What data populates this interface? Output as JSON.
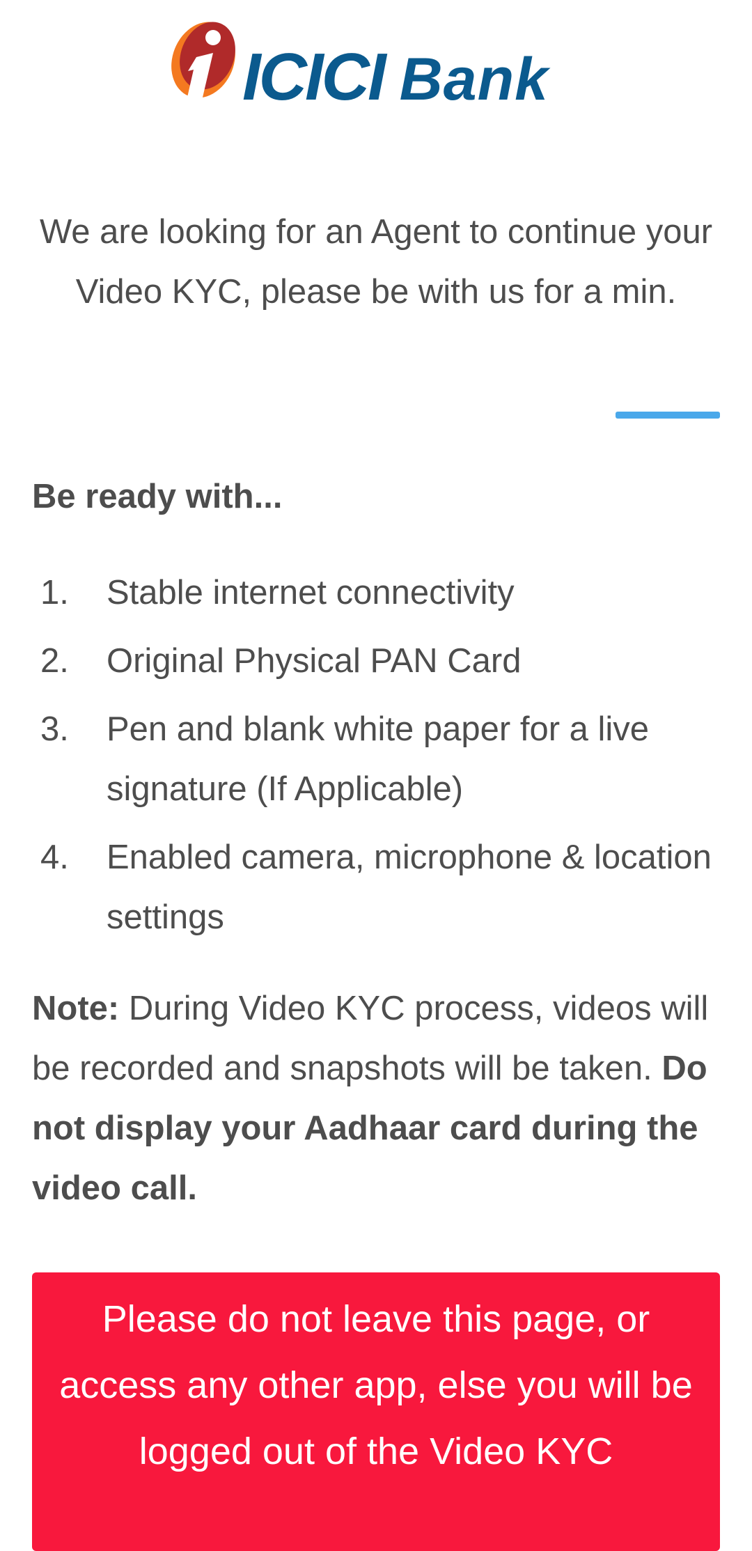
{
  "brand": {
    "name_part1": "ICICI",
    "name_part2": "Bank",
    "primary_color": "#0b5a8e",
    "logo_colors": [
      "#b02a2a",
      "#f47920"
    ]
  },
  "waiting": {
    "message": "We are looking for an Agent to continue your Video KYC, please be with us for a min."
  },
  "loader": {
    "color": "#4aa8ea"
  },
  "checklist": {
    "heading": "Be ready with...",
    "items": [
      {
        "num": "1.",
        "text": "Stable internet connectivity"
      },
      {
        "num": "2.",
        "text": "Original Physical PAN Card"
      },
      {
        "num": "3.",
        "text": "Pen and blank white paper for a live signature (If Applicable)"
      },
      {
        "num": "4.",
        "text": "Enabled camera, microphone & location settings"
      }
    ]
  },
  "note": {
    "label": "Note:",
    "text": " During Video KYC process, videos will be recorded and snapshots will be taken. ",
    "emphasis": "Do not display your Aadhaar card during the video call."
  },
  "warning": {
    "message": "Please do not leave this page, or access any other app, else you will be logged out of the Video KYC",
    "background_color": "#f8183d"
  }
}
